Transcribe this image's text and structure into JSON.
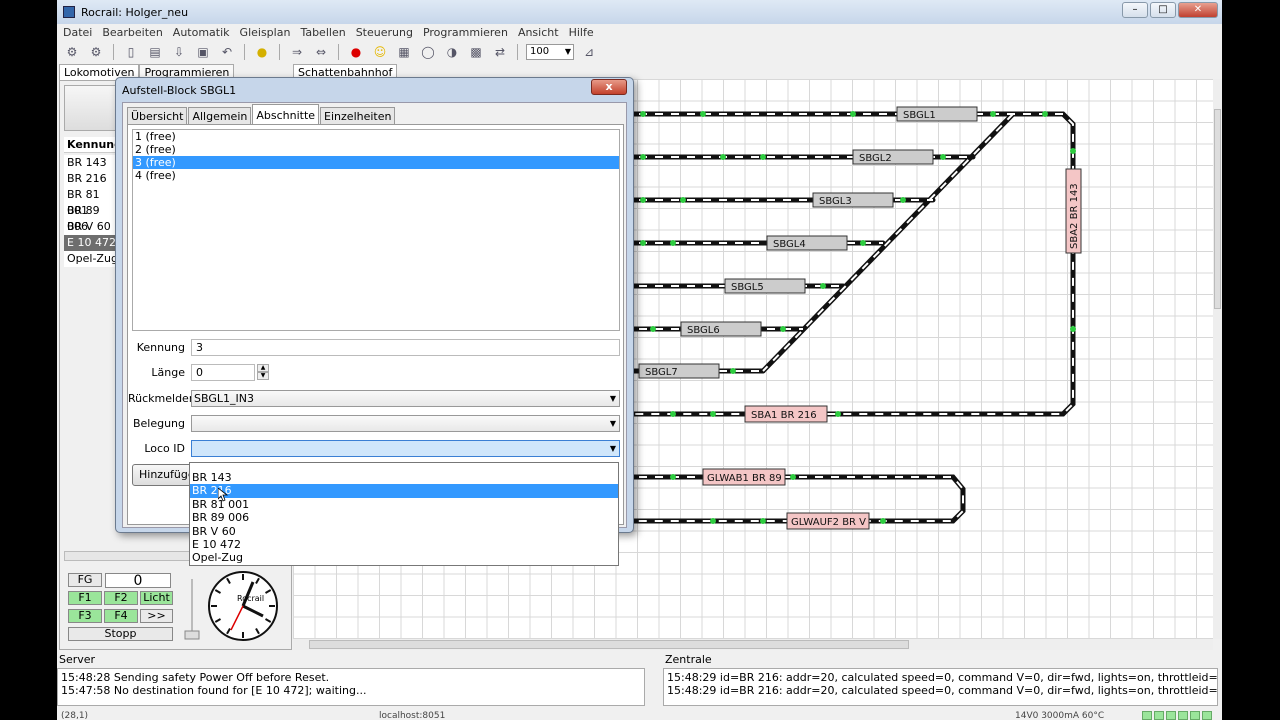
{
  "window": {
    "title": "Rocrail: Holger_neu"
  },
  "menu": [
    "Datei",
    "Bearbeiten",
    "Automatik",
    "Gleisplan",
    "Tabellen",
    "Steuerung",
    "Programmieren",
    "Ansicht",
    "Hilfe"
  ],
  "toolbar": {
    "zoom": "100"
  },
  "left_tabs": [
    "Lokomotiven",
    "Programmieren"
  ],
  "loco_table": {
    "header": "Kennung",
    "rows": [
      "BR 143",
      "BR 216",
      "BR 81 001",
      "BR 89 006",
      "BR V 60",
      "E 10 472",
      "Opel-Zug"
    ],
    "selected": "E 10 472"
  },
  "throttle": {
    "counter": "0",
    "buttons": [
      "FG",
      "F1",
      "F2",
      "Licht",
      "F3",
      "F4",
      ">>",
      "Stopp"
    ],
    "clock_brand": "Rocrail"
  },
  "layout": {
    "tab": "Schattenbahnhof",
    "blocks": [
      "SBGL1",
      "SBGL2",
      "SBGL3",
      "SBGL4",
      "SBGL5",
      "SBGL6",
      "SBGL7"
    ],
    "occupied": [
      "SBA1 BR 216",
      "SBA2 BR 143",
      "GLWAB1 BR 89",
      "GLWAUF2 BR V"
    ]
  },
  "dialog": {
    "title": "Aufstell-Block SBGL1",
    "close": "x",
    "tabs": [
      "Übersicht",
      "Allgemein",
      "Abschnitte",
      "Einzelheiten"
    ],
    "active_tab": "Abschnitte",
    "sections": [
      "1 (free)",
      "2 (free)",
      "3 (free)",
      "4 (free)"
    ],
    "selected_section": "3 (free)",
    "fields": {
      "kennung_label": "Kennung",
      "kennung": "3",
      "laenge_label": "Länge",
      "laenge": "0",
      "rueckmelder_label": "Rückmelder",
      "rueckmelder": "SBGL1_IN3",
      "belegung_label": "Belegung",
      "belegung": "",
      "locoid_label": "Loco ID",
      "locoid": ""
    },
    "add_button": "Hinzufügen",
    "dropdown": [
      "BR 143",
      "BR 216",
      "BR 81 001",
      "BR 89 006",
      "BR V 60",
      "E 10 472",
      "Opel-Zug"
    ],
    "dropdown_selected": "BR 216"
  },
  "server": {
    "label": "Server",
    "log": [
      "15:48:28 Sending safety Power Off before Reset.",
      "15:47:58 No destination found for [E 10 472]; waiting..."
    ]
  },
  "zentrale": {
    "label": "Zentrale",
    "log": [
      "15:48:29 id=BR 216: addr=20, calculated speed=0, command V=0, dir=fwd, lights=on, throttleid=(null)",
      "15:48:29 id=BR 216: addr=20, calculated speed=0, command V=0, dir=fwd, lights=on, throttleid=(null)"
    ]
  },
  "status": {
    "coords": "(28,1)",
    "host": "localhost:8051",
    "power": "14V0 3000mA 60°C"
  }
}
